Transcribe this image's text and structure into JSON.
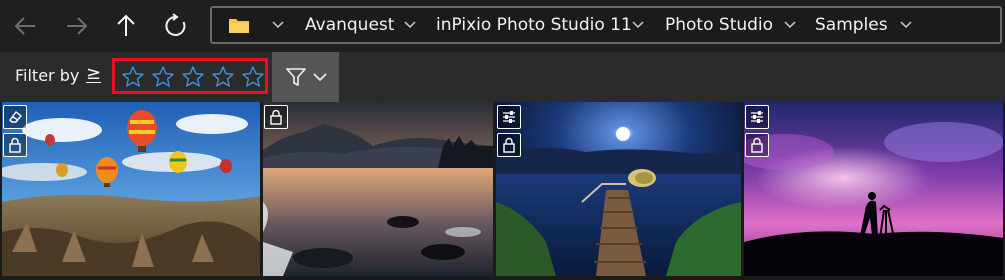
{
  "nav": {
    "back_icon": "arrow-left-icon",
    "forward_icon": "arrow-right-icon",
    "up_icon": "arrow-up-icon",
    "refresh_icon": "refresh-icon",
    "folder_icon": "folder-icon",
    "breadcrumbs": [
      "Avanquest",
      "inPixio Photo Studio 11",
      "Photo Studio",
      "Samples"
    ]
  },
  "filter": {
    "label": "Filter by",
    "operator": "≥",
    "rating_stars": 5,
    "rating_selected": 0,
    "highlight_color": "#e81123",
    "star_color": "#3a8fd8",
    "filter_icon": "funnel-icon"
  },
  "thumbnails": [
    {
      "subject": "hot air balloons over rocky valley",
      "badges": [
        "eraser-icon",
        "lock-icon"
      ]
    },
    {
      "subject": "mountain lake at sunset",
      "badges": [
        "lock-icon"
      ]
    },
    {
      "subject": "wooden pier on lake at night with moon",
      "badges": [
        "sliders-icon",
        "lock-icon"
      ]
    },
    {
      "subject": "photographer silhouette under purple sky",
      "badges": [
        "sliders-icon",
        "lock-icon"
      ]
    }
  ],
  "colors": {
    "background": "#1b1b1b",
    "toolbar": "#2b2b2b",
    "filter_button": "#555555",
    "folder": "#f5c342"
  }
}
